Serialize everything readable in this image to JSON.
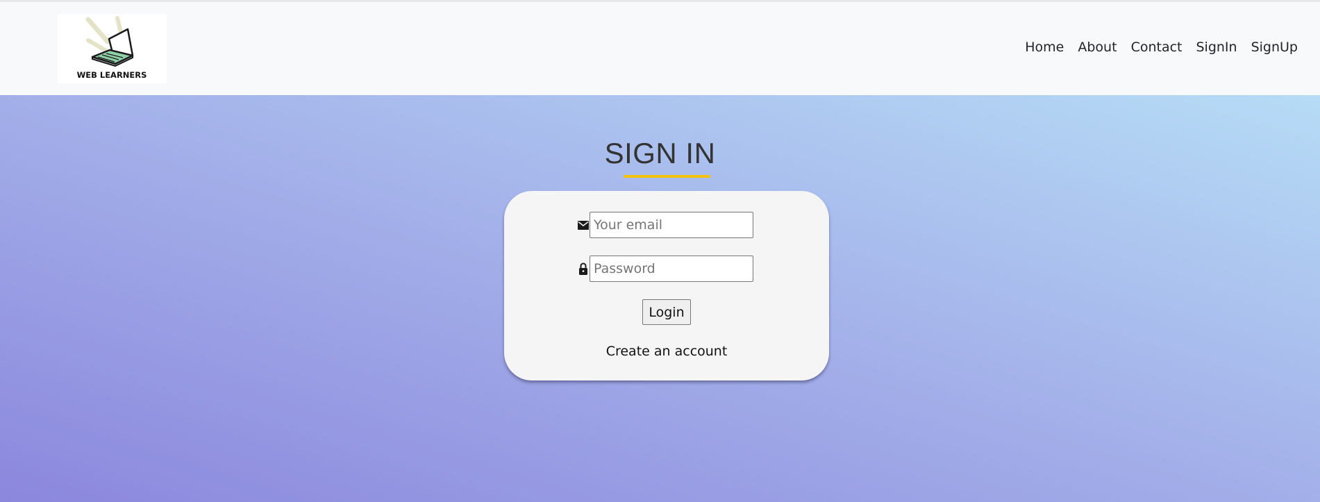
{
  "brand": {
    "logo_text": "WEB LEARNERS"
  },
  "nav": {
    "items": [
      {
        "label": "Home"
      },
      {
        "label": "About"
      },
      {
        "label": "Contact"
      },
      {
        "label": "SignIn"
      },
      {
        "label": "SignUp"
      }
    ]
  },
  "signin": {
    "title": "SIGN IN",
    "email_placeholder": "Your email",
    "email_value": "",
    "password_placeholder": "Password",
    "password_value": "",
    "login_label": "Login",
    "create_account_label": "Create an account"
  },
  "icons": {
    "email": "envelope-icon",
    "password": "lock-icon"
  },
  "colors": {
    "navbar_bg": "#f8f9fa",
    "gradient_start": "#8b87dd",
    "gradient_mid": "#a3afe9",
    "gradient_end": "#b6dcf6",
    "title_underline": "#f4c20d",
    "card_bg": "#f5f5f5"
  }
}
